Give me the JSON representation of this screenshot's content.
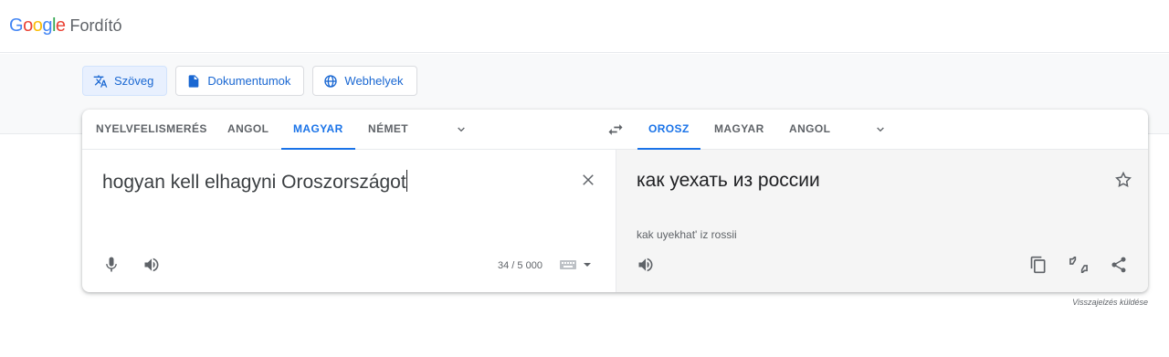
{
  "header": {
    "logo": [
      "G",
      "o",
      "o",
      "g",
      "l",
      "e"
    ],
    "app_name": "Fordító"
  },
  "modes": [
    {
      "label": "Szöveg",
      "icon": "translate-icon",
      "active": true
    },
    {
      "label": "Dokumentumok",
      "icon": "document-icon",
      "active": false
    },
    {
      "label": "Webhelyek",
      "icon": "globe-icon",
      "active": false
    }
  ],
  "source_langs": [
    "NYELVFELISMERÉS",
    "ANGOL",
    "MAGYAR",
    "NÉMET"
  ],
  "source_active": "MAGYAR",
  "target_langs": [
    "OROSZ",
    "MAGYAR",
    "ANGOL"
  ],
  "target_active": "OROSZ",
  "source": {
    "text": "hogyan kell elhagyni Oroszországot",
    "counter": "34 / 5 000"
  },
  "target": {
    "text": "как уехать из россии",
    "transliteration": "kak uyekhat' iz rossii"
  },
  "feedback_link": "Visszajelzés küldése",
  "colors": {
    "accent": "#1a73e8",
    "active_bg": "#e8f0fe",
    "target_bg": "#f5f5f5"
  }
}
